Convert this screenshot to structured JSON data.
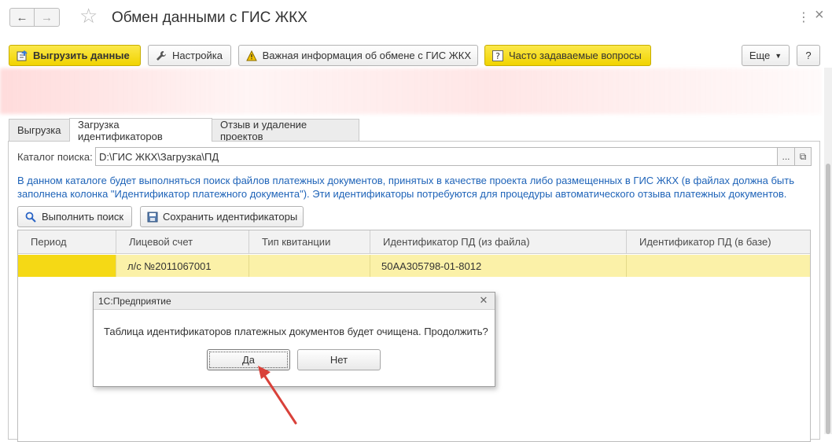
{
  "window": {
    "title": "Обмен данными с ГИС ЖКХ",
    "back_glyph": "←",
    "fwd_glyph": "→",
    "favorite_icon": "star-icon",
    "more_glyph": "⋮",
    "close_glyph": "×"
  },
  "toolbar": {
    "upload_label": "Выгрузить данные",
    "settings_label": "Настройка",
    "important_label": "Важная информация об обмене с ГИС ЖКХ",
    "faq_label": "Часто задаваемые вопросы",
    "more_label": "Еще",
    "help_label": "?"
  },
  "tabs": [
    {
      "label": "Выгрузка"
    },
    {
      "label": "Загрузка идентификаторов"
    },
    {
      "label": "Отзыв и удаление проектов"
    }
  ],
  "catalog": {
    "label": "Каталог поиска:",
    "value": "D:\\ГИС ЖКХ\\Загрузка\\ПД",
    "browse_label": "...",
    "open_glyph": "⧉"
  },
  "info_text": "В данном каталоге будет выполняться поиск файлов платежных документов, принятых в качестве проекта либо размещенных в ГИС ЖКХ (в файлах должна быть заполнена колонка \"Идентификатор платежного документа\"). Эти идентификаторы потребуются для процедуры автоматического отзыва платежных документов.",
  "actions": {
    "search_label": "Выполнить поиск",
    "save_label": "Сохранить идентификаторы"
  },
  "table": {
    "columns": [
      "Период",
      "Лицевой счет",
      "Тип квитанции",
      "Идентификатор ПД (из файла)",
      "Идентификатор ПД (в базе)"
    ],
    "rows": [
      {
        "period": "",
        "account": "л/с №2011067001",
        "type": "",
        "id_file": "50АА305798-01-8012",
        "id_base": ""
      }
    ]
  },
  "dialog": {
    "title": "1С:Предприятие",
    "message": "Таблица идентификаторов платежных документов будет очищена. Продолжить?",
    "yes_label": "Да",
    "no_label": "Нет",
    "close_glyph": "✕"
  },
  "colors": {
    "accent_yellow": "#f5dc1f",
    "row_highlight": "#fbf1a8",
    "info_blue": "#1e63b8",
    "arrow_red": "#d9413a"
  }
}
